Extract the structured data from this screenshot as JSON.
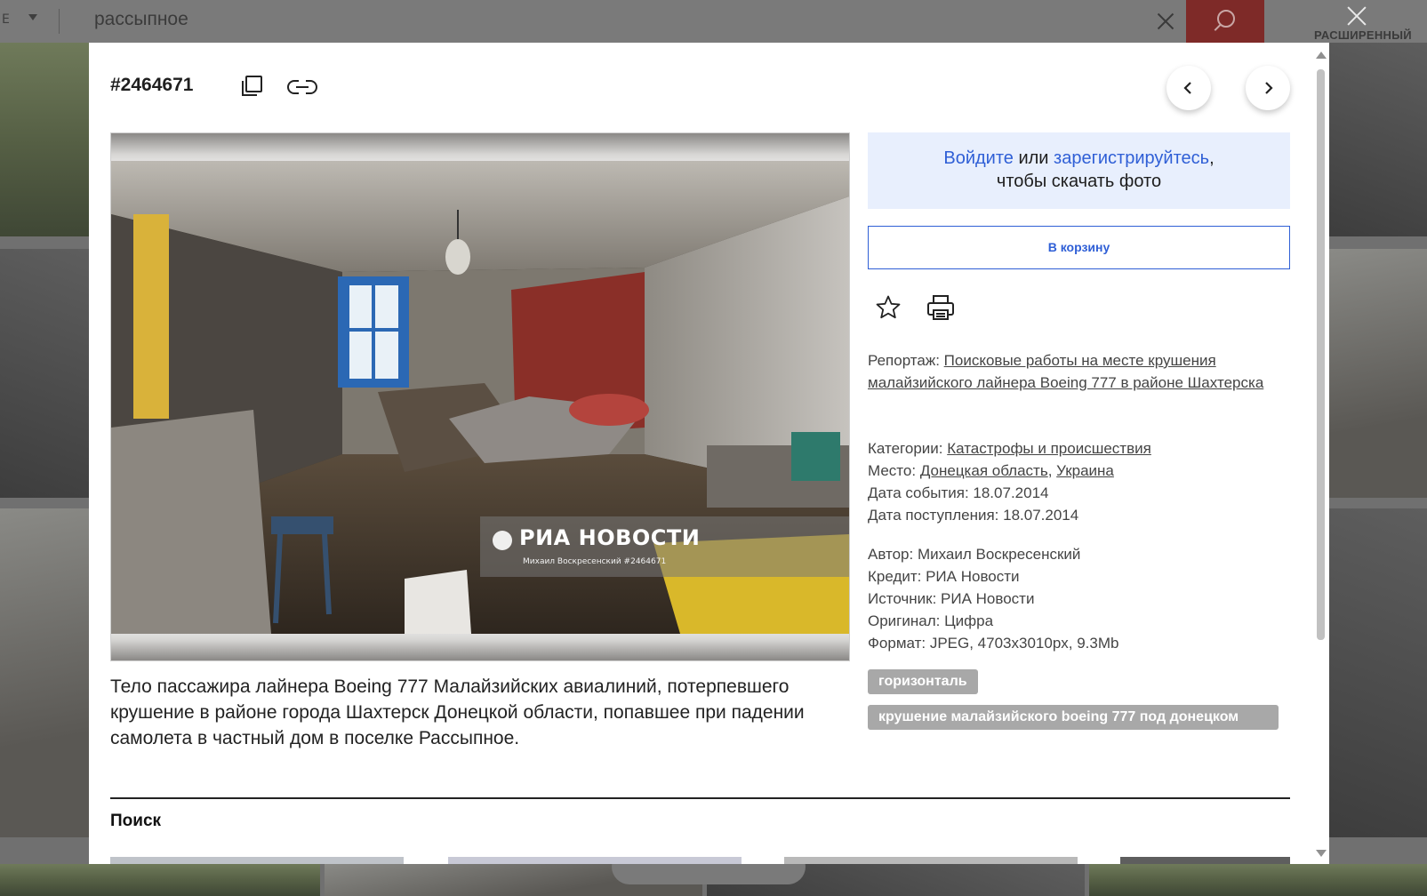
{
  "search_bar": {
    "mode_label": "Е",
    "query": "рассыпное",
    "advanced_label": "РАСШИРЕННЫЙ"
  },
  "modal": {
    "photo_id": "#2464671",
    "photo": {
      "watermark_title": "РИА НОВОСТИ",
      "watermark_subtitle": "Михаил Воскресенский #2464671"
    },
    "caption": "Тело пассажира лайнера Boeing 777 Малайзийских авиалиний, потерпевшего крушение в районе города Шахтерск Донецкой области, попавшее при падении самолета в частный дом в поселке Рассыпное.",
    "login": {
      "login_link": "Войдите",
      "or_text": " или ",
      "register_link": "зарегистрируйтесь",
      "comma": ",",
      "suffix": "чтобы скачать фото"
    },
    "cart_button": "В корзину",
    "report": {
      "label": "Репортаж: ",
      "value": "Поисковые работы на месте крушения малайзийского лайнера Boeing 777 в районе Шахтерска"
    },
    "info": {
      "categories_label": "Категории: ",
      "categories_value": "Катастрофы и происшествия",
      "place_label": "Место: ",
      "place_region": "Донецкая область",
      "place_sep": ", ",
      "place_country": "Украина",
      "event_date": "Дата события: 18.07.2014",
      "received_date": "Дата поступления: 18.07.2014"
    },
    "tech": {
      "author": "Автор: Михаил Воскресенский",
      "credit": "Кредит: РИА Новости",
      "source": "Источник: РИА Новости",
      "original": "Оригинал: Цифра",
      "format": "Формат: JPEG, 4703x3010px, 9.3Mb"
    },
    "tags": [
      "горизонталь",
      "крушение малайзийского boeing 777 под донецком"
    ],
    "search_section_title": "Поиск"
  },
  "colors": {
    "accent_blue": "#2f5fd6",
    "login_bg": "#e8effd",
    "search_button_red": "#c0392b",
    "tag_bg": "#a8a8a8"
  }
}
